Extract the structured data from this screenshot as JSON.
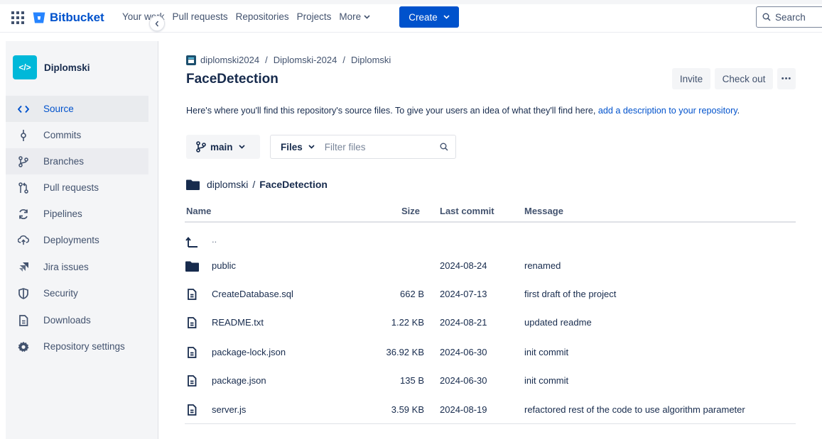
{
  "header": {
    "product": "Bitbucket",
    "nav": [
      "Your work",
      "Pull requests",
      "Repositories",
      "Projects"
    ],
    "more_label": "More",
    "create_label": "Create",
    "search_label": "Search",
    "brand_color": "#0052cc"
  },
  "sidebar": {
    "repo_avatar": "</>",
    "repo_name": "Diplomski",
    "items": [
      {
        "label": "Source",
        "icon": "code-icon"
      },
      {
        "label": "Commits",
        "icon": "commit-icon"
      },
      {
        "label": "Branches",
        "icon": "branch-icon"
      },
      {
        "label": "Pull requests",
        "icon": "pull-request-icon"
      },
      {
        "label": "Pipelines",
        "icon": "pipelines-icon"
      },
      {
        "label": "Deployments",
        "icon": "cloud-upload-icon"
      },
      {
        "label": "Jira issues",
        "icon": "jira-icon"
      },
      {
        "label": "Security",
        "icon": "shield-icon"
      },
      {
        "label": "Downloads",
        "icon": "file-icon"
      },
      {
        "label": "Repository settings",
        "icon": "gear-icon"
      }
    ]
  },
  "breadcrumb": [
    "diplomski2024",
    "Diplomski-2024",
    "Diplomski"
  ],
  "repo_title": "FaceDetection",
  "actions": {
    "invite": "Invite",
    "checkout": "Check out",
    "more": "•••"
  },
  "description": {
    "text": "Here's where you'll find this repository's source files. To give your users an idea of what they'll find here, ",
    "link": "add a description to your repository",
    "end": "."
  },
  "branch": {
    "current": "main"
  },
  "filter": {
    "files_label": "Files",
    "placeholder": "Filter files"
  },
  "path": {
    "parent": "diplomski",
    "current": "FaceDetection"
  },
  "table": {
    "columns": [
      "Name",
      "Size",
      "Last commit",
      "Message"
    ],
    "parent_row": "..",
    "rows": [
      {
        "type": "folder",
        "name": "public",
        "size": "",
        "date": "2024-08-24",
        "message": "renamed"
      },
      {
        "type": "file",
        "name": "CreateDatabase.sql",
        "size": "662 B",
        "date": "2024-07-13",
        "message": "first draft of the project"
      },
      {
        "type": "file",
        "name": "README.txt",
        "size": "1.22 KB",
        "date": "2024-08-21",
        "message": "updated readme"
      },
      {
        "type": "file",
        "name": "package-lock.json",
        "size": "36.92 KB",
        "date": "2024-06-30",
        "message": "init commit"
      },
      {
        "type": "file",
        "name": "package.json",
        "size": "135 B",
        "date": "2024-06-30",
        "message": "init commit"
      },
      {
        "type": "file",
        "name": "server.js",
        "size": "3.59 KB",
        "date": "2024-08-19",
        "message": "refactored rest of the code to use algorithm parameter"
      }
    ]
  }
}
